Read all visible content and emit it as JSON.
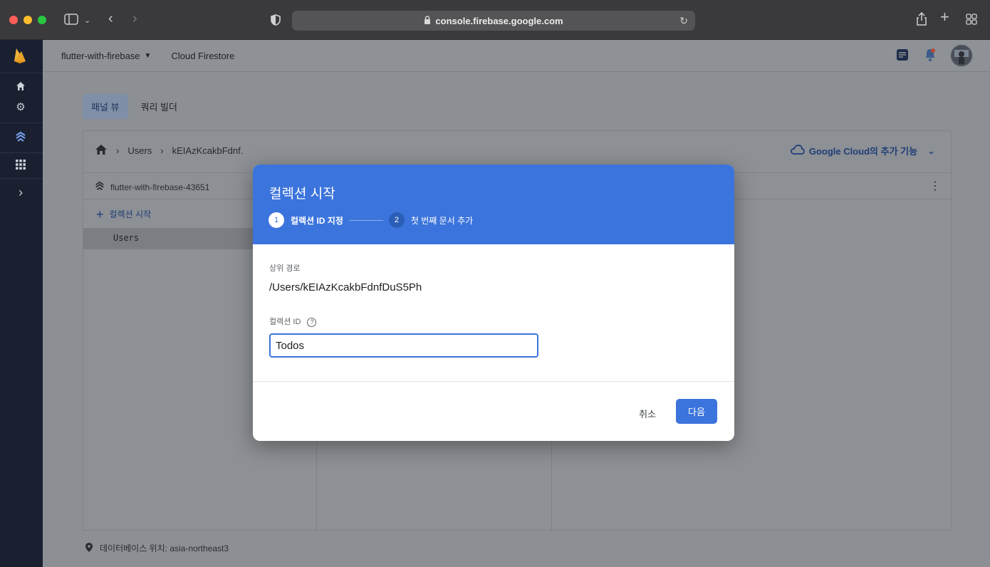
{
  "browser": {
    "url": "console.firebase.google.com"
  },
  "topbar": {
    "project": "flutter-with-firebase",
    "product": "Cloud Firestore"
  },
  "tabs": [
    {
      "label": "패널 뷰",
      "active": true
    },
    {
      "label": "쿼리 빌더",
      "active": false
    }
  ],
  "breadcrumb": {
    "items": [
      "Users",
      "kEIAzKcakbFdnf."
    ]
  },
  "google_cloud_extra": "Google Cloud의 추가 기능",
  "database": {
    "name": "flutter-with-firebase-43651",
    "start_collection": "컬렉션 시작",
    "collections": [
      "Users"
    ]
  },
  "footer": {
    "location_text": "데이터베이스 위치: asia-northeast3"
  },
  "dialog": {
    "title": "컬렉션 시작",
    "steps": [
      {
        "num": "1",
        "label": "컬렉션 ID 지정",
        "active": true
      },
      {
        "num": "2",
        "label": "첫 번째 문서 추가",
        "active": false
      }
    ],
    "parent_path_label": "상위 경로",
    "parent_path_value": "/Users/kEIAzKcakbFdnfDuS5Ph",
    "collection_id_label": "컬렉션 ID",
    "collection_id_help": "?",
    "collection_id_value": "Todos",
    "cancel_label": "취소",
    "next_label": "다음"
  },
  "colors": {
    "accent": "#3b74dc",
    "rail_bg": "#1a2030",
    "overlay_bg": "#8c8f94"
  }
}
